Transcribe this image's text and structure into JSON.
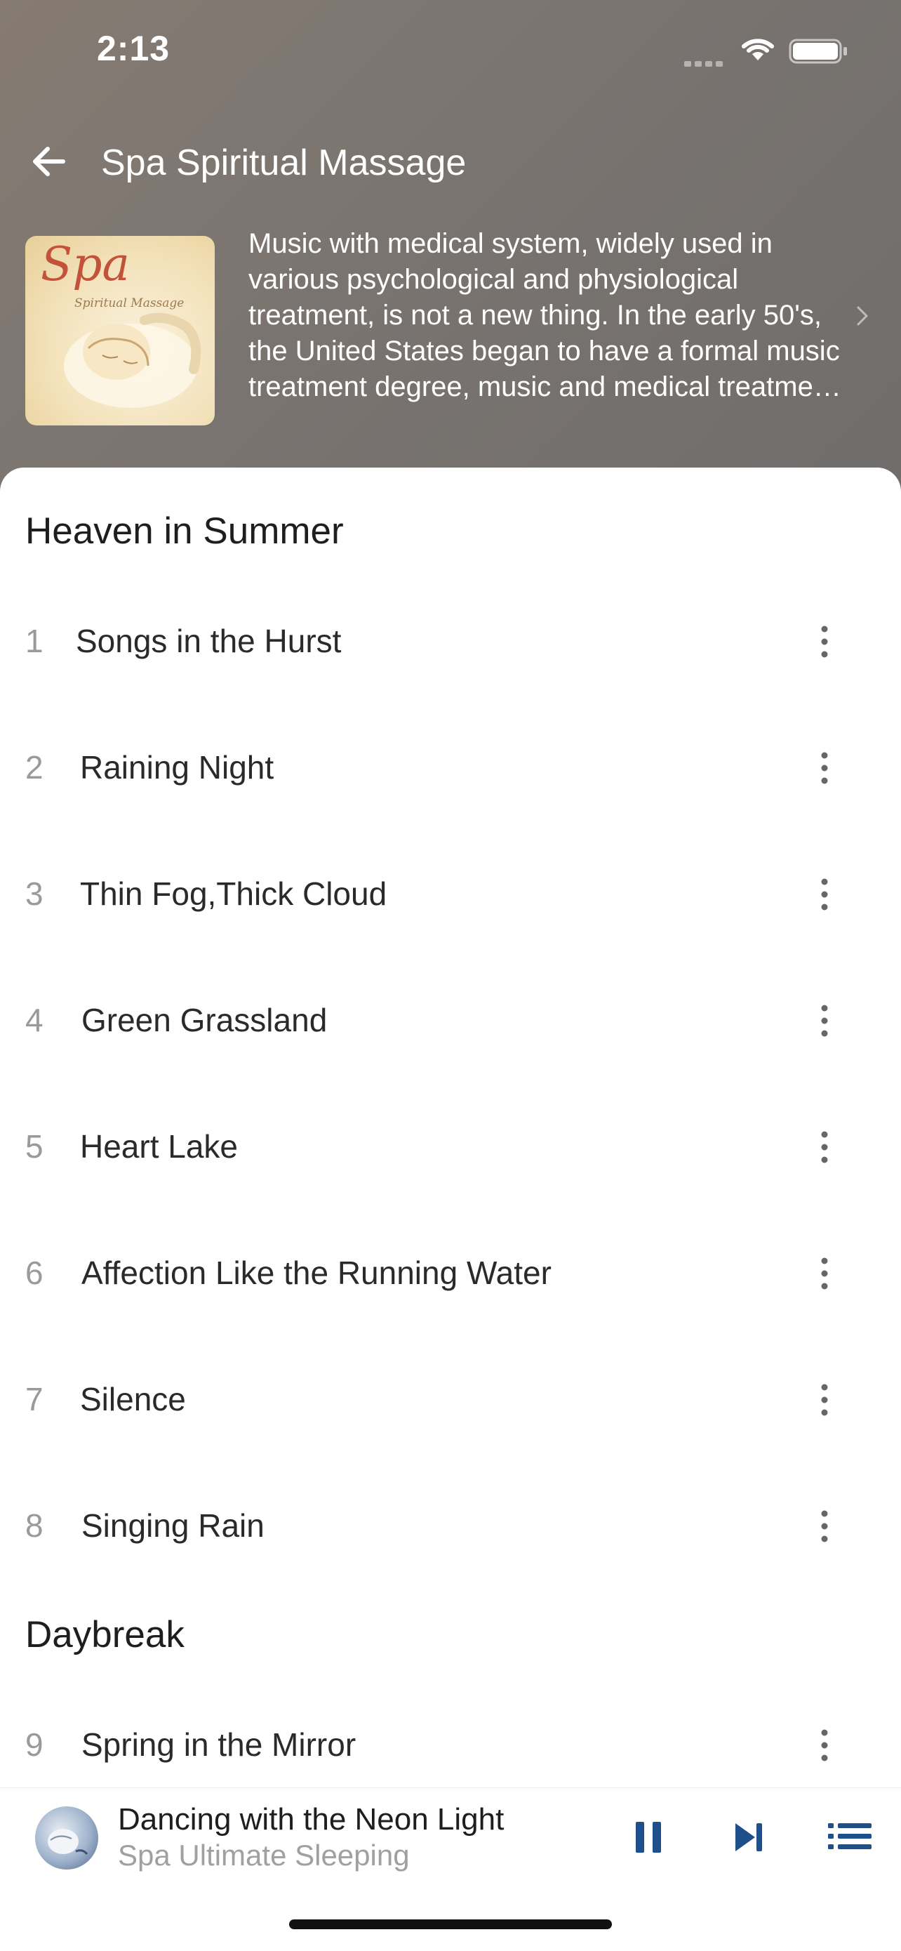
{
  "status_bar": {
    "time": "2:13"
  },
  "header": {
    "title": "Spa Spiritual Massage",
    "album_cover_text": {
      "title": "Spa",
      "subtitle": "Spiritual Massage"
    },
    "description": "Music with medical system, widely used in various psychological and physiological treatment, is not a new thing. In the early 50's, the United States began to have a formal music treatment degree, music and medical treatment are combined."
  },
  "sections": [
    {
      "title": "Heaven in Summer",
      "tracks": [
        {
          "number": "1",
          "title": "Songs in the Hurst"
        },
        {
          "number": "2",
          "title": "Raining Night"
        },
        {
          "number": "3",
          "title": "Thin Fog,Thick Cloud"
        },
        {
          "number": "4",
          "title": "Green Grassland"
        },
        {
          "number": "5",
          "title": "Heart Lake"
        },
        {
          "number": "6",
          "title": "Affection Like the Running Water"
        },
        {
          "number": "7",
          "title": "Silence"
        },
        {
          "number": "8",
          "title": "Singing Rain"
        }
      ]
    },
    {
      "title": "Daybreak",
      "tracks": [
        {
          "number": "9",
          "title": "Spring in the Mirror"
        }
      ]
    }
  ],
  "now_playing": {
    "title": "Dancing with the Neon Light",
    "subtitle": "Spa Ultimate Sleeping",
    "state": "playing"
  },
  "colors": {
    "header_bg": "#7a7470",
    "accent": "#1f4f8a",
    "track_number": "#9a9a9a",
    "track_title": "#2a2a2a",
    "subtitle_gray": "#a0a0a0"
  },
  "icons": {
    "back": "back-arrow-icon",
    "more": "more-vertical-icon",
    "pause": "pause-icon",
    "next": "skip-next-icon",
    "playlist": "playlist-icon",
    "chevron": "chevron-right-icon"
  }
}
